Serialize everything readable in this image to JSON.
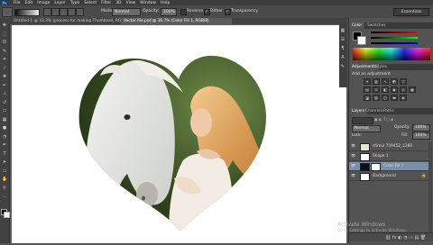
{
  "menubar": {
    "logo": "Ps",
    "items": [
      "File",
      "Edit",
      "Image",
      "Layer",
      "Type",
      "Select",
      "Filter",
      "3D",
      "View",
      "Window",
      "Help"
    ]
  },
  "options": {
    "mode_label": "Mode:",
    "mode_value": "Normal",
    "opacity_label": "Opacity:",
    "opacity_value": "100%",
    "reverse_label": "Reverse",
    "dither_label": "Dither",
    "transparency_label": "Transparency",
    "workspace": "Essentials"
  },
  "tabs": [
    {
      "label": "Untitled-1 @ 33.3% (process for making Thumbnail, RGB/8) *",
      "active": false
    },
    {
      "label": "Vector file.psd @ 36.7% (Color Fill 1, RGB/8)",
      "active": true
    }
  ],
  "panels": {
    "color_tabs": [
      "Color",
      "Swatches"
    ],
    "adjust_tabs": [
      "Adjustments",
      "Styles"
    ],
    "adjust_title": "Add an adjustment",
    "layers_tabs": [
      "Layers",
      "Channels",
      "Paths"
    ],
    "blend_mode": "Normal",
    "opacity_label": "Opacity:",
    "opacity_value": "100%",
    "fill_label": "Fill:",
    "fill_value": "100%",
    "layers": [
      {
        "name": "stimul 759452_1280",
        "selected": false
      },
      {
        "name": "Shape 1",
        "selected": false
      },
      {
        "name": "Color Fill 1",
        "selected": true
      },
      {
        "name": "Background",
        "selected": false
      }
    ]
  },
  "watermark": {
    "line1": "Activate Windows",
    "line2": "Go to Settings to activate Windows."
  }
}
